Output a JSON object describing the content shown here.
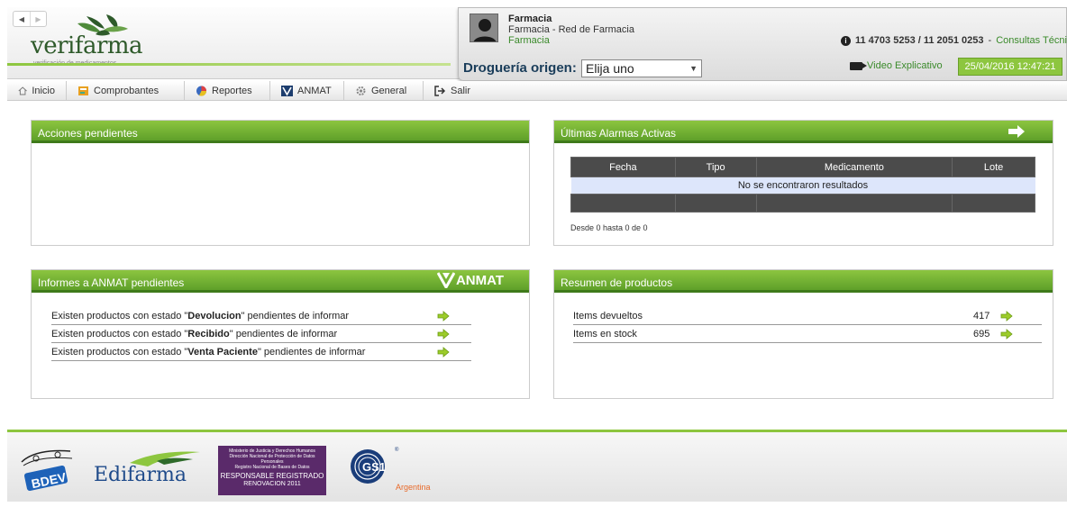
{
  "header": {
    "logo_text": "verifarma",
    "logo_sub": "verificación de medicamentos",
    "user_name": "Farmacia",
    "user_line2": "Farmacia - Red de Farmacia",
    "user_line3": "Farmacia",
    "drogueria_label": "Droguería origen:",
    "drogueria_value": "Elija uno",
    "phones": "11 4703 5253 / 11 2051 0253",
    "separator": "-",
    "consultas": "Consultas Técnicas",
    "video": "Video Explicativo",
    "datetime": "25/04/2016 12:47:21"
  },
  "menu": [
    {
      "label": "Inicio",
      "icon": "home-icon"
    },
    {
      "label": "Comprobantes",
      "icon": "receipt-icon"
    },
    {
      "label": "Reportes",
      "icon": "pie-chart-icon"
    },
    {
      "label": "ANMAT",
      "icon": "anmat-icon"
    },
    {
      "label": "General",
      "icon": "gear-icon"
    },
    {
      "label": "Salir",
      "icon": "exit-icon"
    }
  ],
  "panels": {
    "acciones": {
      "title": "Acciones pendientes"
    },
    "alarmas": {
      "title": "Últimas Alarmas Activas",
      "columns": [
        "Fecha",
        "Tipo",
        "Medicamento",
        "Lote"
      ],
      "empty": "No se encontraron resultados",
      "range": "Desde 0 hasta 0 de 0"
    },
    "informes": {
      "title": "Informes a ANMAT pendientes",
      "logo": "ANMAT",
      "prefix": "Existen productos con estado \"",
      "suffix": "\" pendientes de informar",
      "rows": [
        {
          "state": "Devolucion"
        },
        {
          "state": "Recibido"
        },
        {
          "state": "Venta Paciente"
        }
      ]
    },
    "resumen": {
      "title": "Resumen de productos",
      "rows": [
        {
          "label": "Items devueltos",
          "value": "417"
        },
        {
          "label": "Items en stock",
          "value": "695"
        }
      ]
    }
  },
  "footer": {
    "logos": [
      "BDEV",
      "Edifarma",
      "Registro Nacional de Bases de Datos",
      "GS1 Argentina"
    ],
    "edifarma": "Edifarma",
    "reg_line1": "Ministerio de Justicia y Derechos Humanos",
    "reg_line2": "Dirección Nacional de Protección de Datos Personales",
    "reg_line3": "Registro Nacional de Bases de Datos",
    "reg_line4": "RESPONSABLE REGISTRADO",
    "reg_line5": "RENOVACION 2011",
    "gs1": "GS1",
    "gs1_sub": "Argentina",
    "bdev": "BDEV"
  },
  "colors": {
    "green": "#8dc63f",
    "dark_green": "#3f7a1a",
    "link_green": "#3a8a2a"
  }
}
